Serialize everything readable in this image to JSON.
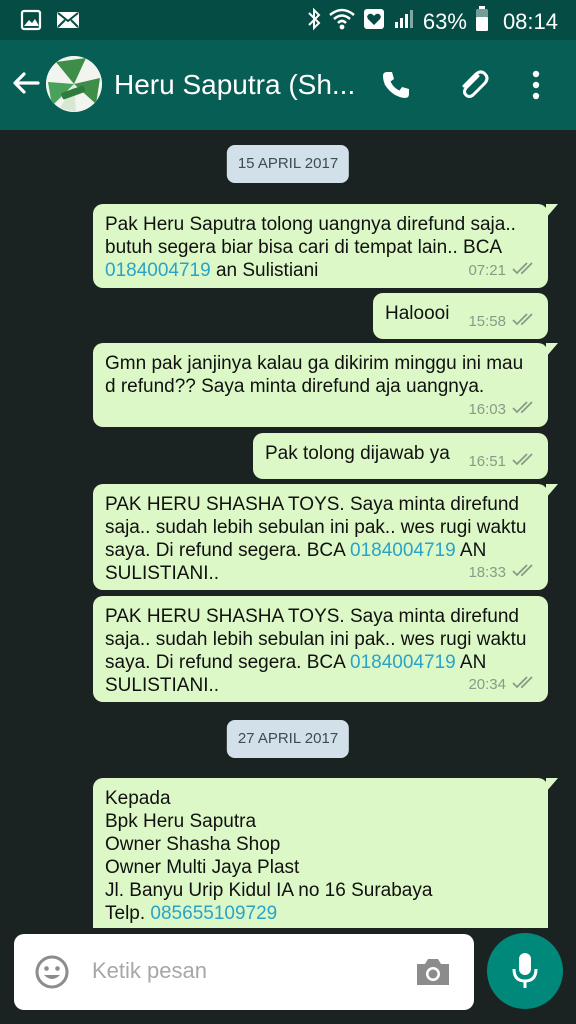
{
  "status_bar": {
    "battery": "63%",
    "time": "08:14",
    "icons": [
      "image-icon",
      "email-icon",
      "bluetooth-icon",
      "wifi-icon",
      "heart-box-icon",
      "signal-icon",
      "battery-icon"
    ]
  },
  "header": {
    "contact_name": "Heru Saputra (Sh...",
    "actions": [
      "back-arrow-icon",
      "phone-icon",
      "paperclip-icon",
      "more-vert-icon"
    ]
  },
  "chat": {
    "date1": "15 APRIL 2017",
    "date2": "27 APRIL 2017",
    "messages": [
      {
        "text_line1": "Pak Heru Saputra tolong uangnya direfund saja..",
        "text_line2": "butuh segera biar bisa cari di tempat lain.. BCA",
        "link": "0184004719",
        "text_after": " an Sulistiani",
        "time": "07:21"
      },
      {
        "text": "Haloooi",
        "time": "15:58"
      },
      {
        "text_line1": "Gmn pak janjinya kalau ga dikirim minggu ini mau",
        "text_line2": "d refund?? Saya minta direfund aja uangnya.",
        "time": "16:03"
      },
      {
        "text": "Pak tolong dijawab ya",
        "time": "16:51"
      },
      {
        "text_line1": "PAK HERU SHASHA TOYS. Saya minta direfund",
        "text_line2": "saja.. sudah lebih sebulan ini pak.. wes rugi waktu",
        "text_line3": "saya. Di refund segera. BCA ",
        "link": "0184004719",
        "text_after": " AN",
        "text_line4": "SULISTIANI..",
        "time": "18:33"
      },
      {
        "text_line1": "PAK HERU SHASHA TOYS. Saya minta direfund",
        "text_line2": "saja.. sudah lebih sebulan ini pak.. wes rugi waktu",
        "text_line3": "saya. Di refund segera. BCA ",
        "link": "0184004719",
        "text_after": " AN",
        "text_line4": "SULISTIANI..",
        "time": "20:34"
      },
      {
        "line1": "Kepada",
        "line2": "Bpk Heru Saputra",
        "line3": "Owner Shasha Shop",
        "line4": "Owner Multi Jaya Plast",
        "line5": "Jl. Banyu Urip Kidul IA no 16 Surabaya",
        "line6_prefix": "Telp. ",
        "link": "085655109729"
      }
    ]
  },
  "input": {
    "placeholder": "Ketik pesan"
  },
  "colors": {
    "header": "#075e54",
    "status_bar": "#054d44",
    "bubble": "#dcf8c6",
    "link": "#2aa3c9",
    "mic": "#00897b"
  }
}
